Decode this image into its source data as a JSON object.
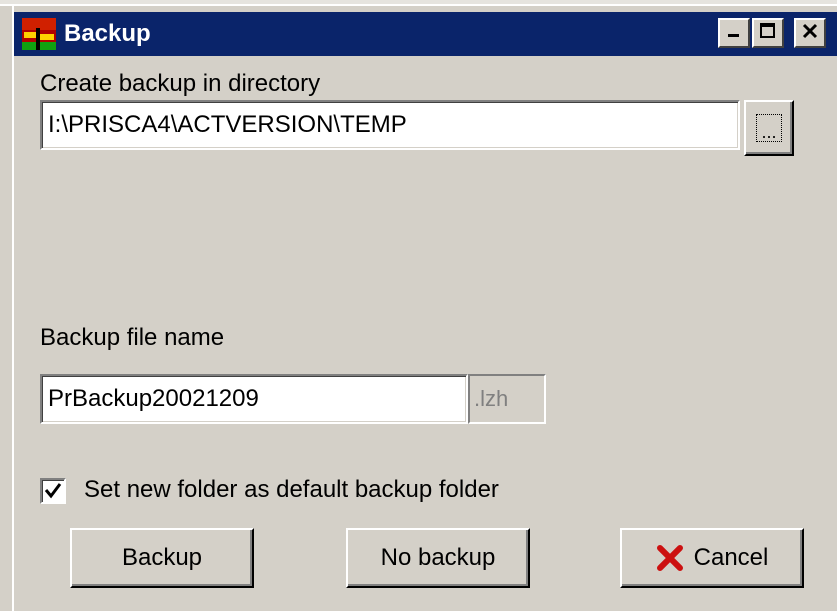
{
  "window": {
    "title": "Backup",
    "minimize_icon": "minimize-icon",
    "maximize_icon": "maximize-icon",
    "close_icon": "close-icon"
  },
  "directory": {
    "label": "Create backup in directory",
    "value": "I:\\PRISCA4\\ACTVERSION\\TEMP",
    "browse_label": "..."
  },
  "filename": {
    "label": "Backup file name",
    "value": "PrBackup20021209",
    "extension": ".lzh"
  },
  "default_folder": {
    "checked": true,
    "label": "Set new folder as default backup folder"
  },
  "buttons": {
    "backup": "Backup",
    "no_backup": "No backup",
    "cancel": "Cancel",
    "cancel_icon": "red-x-icon"
  },
  "colors": {
    "titlebar": "#0a246a",
    "face": "#d4d0c8",
    "cancel_x": "#cc1010"
  }
}
